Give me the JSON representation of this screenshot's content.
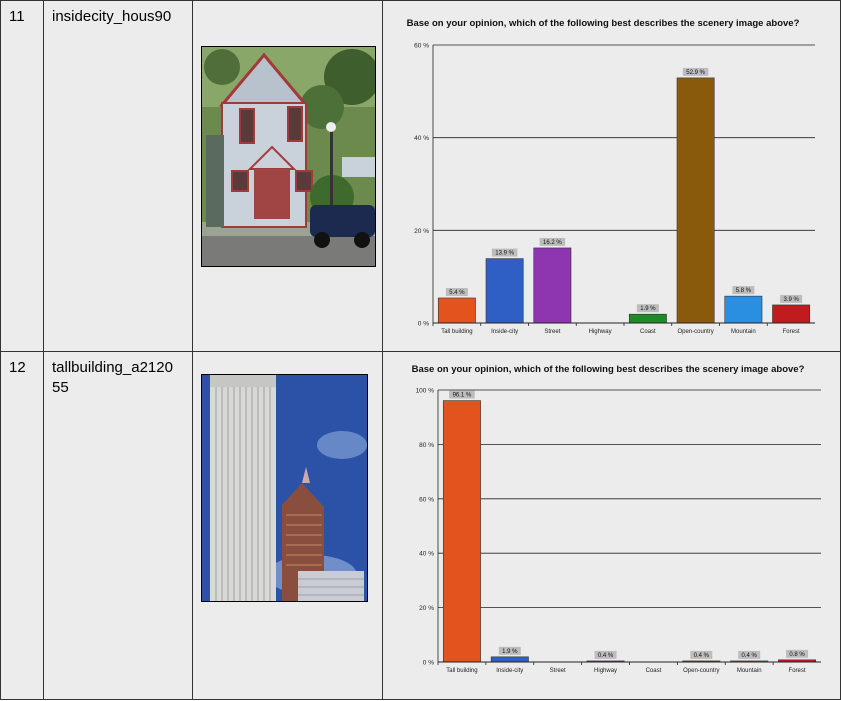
{
  "rows": [
    {
      "index": "11",
      "image_name": "insidecity_hous90",
      "photo_icon": "house-photo"
    },
    {
      "index": "12",
      "image_name": "tallbuilding_a212055",
      "photo_icon": "skyscraper-photo"
    }
  ],
  "chart_data": [
    {
      "type": "bar",
      "title": "Base on your opinion, which of the following best describes the scenery image above?",
      "categories": [
        "Tall building",
        "Inside-city",
        "Street",
        "Highway",
        "Coast",
        "Open-country",
        "Mountain",
        "Forest"
      ],
      "values": [
        5.4,
        13.9,
        16.2,
        0,
        1.9,
        52.9,
        5.8,
        3.9
      ],
      "data_labels": [
        "5.4 %",
        "13.9 %",
        "16.2 %",
        "",
        "1.9 %",
        "52.9 %",
        "5.8 %",
        "3.9 %"
      ],
      "colors": [
        "#e3531d",
        "#2f5ec4",
        "#8e35b0",
        "#888888",
        "#1f8a2a",
        "#8a5a0c",
        "#2a8fe0",
        "#c01c20"
      ],
      "ylim": [
        0,
        60
      ],
      "yticks": [
        "0 %",
        "20 %",
        "40 %",
        "60 %"
      ],
      "ytick_values": [
        0,
        20,
        40,
        60
      ],
      "grid": true,
      "xlabel": "",
      "ylabel": ""
    },
    {
      "type": "bar",
      "title": "Base on your opinion, which of the following best describes the scenery image above?",
      "categories": [
        "Tall building",
        "Inside-city",
        "Street",
        "Highway",
        "Coast",
        "Open-country",
        "Mountain",
        "Forest"
      ],
      "values": [
        96.1,
        1.9,
        0,
        0.4,
        0,
        0.4,
        0.4,
        0.8
      ],
      "data_labels": [
        "96.1 %",
        "1.9 %",
        "",
        "0.4 %",
        "",
        "0.4 %",
        "0.4 %",
        "0.8 %"
      ],
      "colors": [
        "#e3531d",
        "#2f5ec4",
        "#8e35b0",
        "#8e35b0",
        "#1f8a2a",
        "#8a5a0c",
        "#2a8fe0",
        "#c01c20"
      ],
      "ylim": [
        0,
        100
      ],
      "yticks": [
        "0 %",
        "20 %",
        "40 %",
        "60 %",
        "80 %",
        "100 %"
      ],
      "ytick_values": [
        0,
        20,
        40,
        60,
        80,
        100
      ],
      "grid": true,
      "xlabel": "",
      "ylabel": ""
    }
  ]
}
